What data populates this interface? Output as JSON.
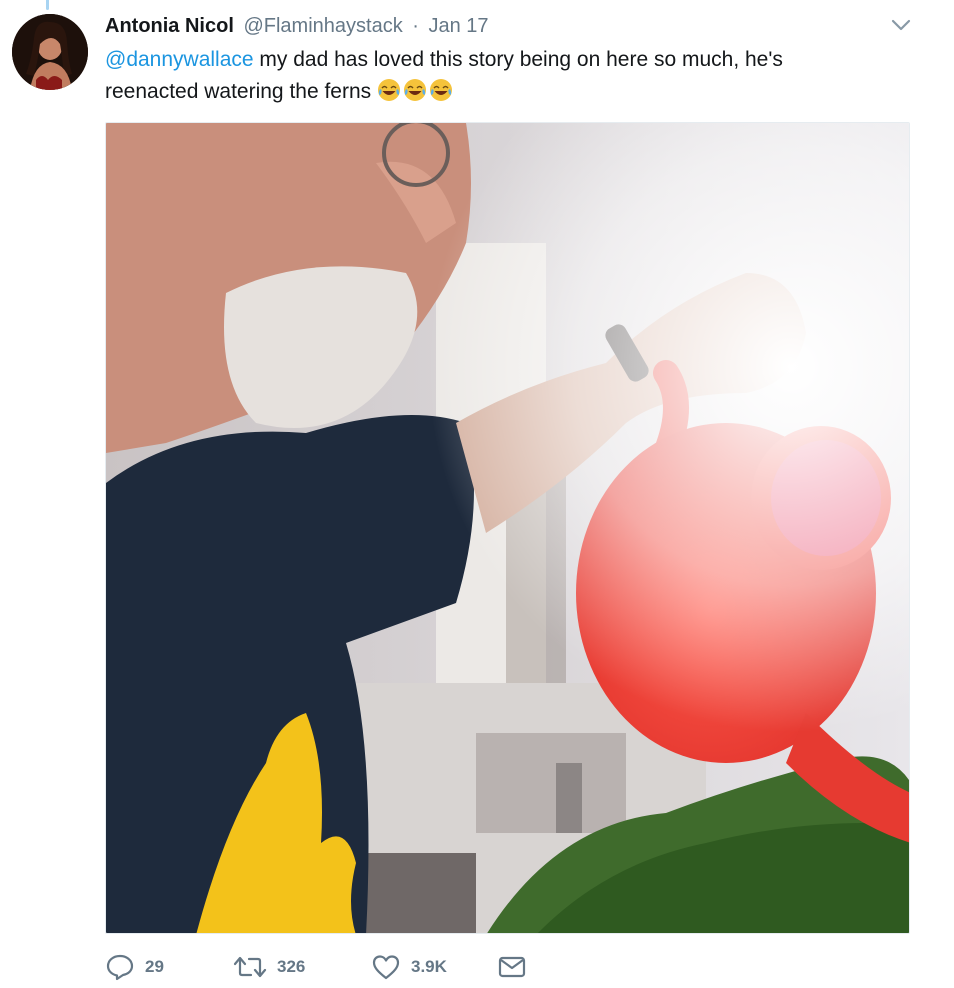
{
  "tweet": {
    "display_name": "Antonia Nicol",
    "handle": "@Flaminhaystack",
    "separator": "·",
    "date": "Jan 17",
    "mention": "@dannywallace",
    "text_line1": " my dad has loved this story being on here so much, he's",
    "text_line2": "reenacted watering the ferns ",
    "emoji": [
      "face-with-tears-of-joy",
      "face-with-tears-of-joy",
      "face-with-tears-of-joy"
    ]
  },
  "media": {
    "description_icon": "photo"
  },
  "actions": {
    "reply_icon": "reply-icon",
    "reply_count": "29",
    "retweet_icon": "retweet-icon",
    "retweet_count": "326",
    "like_icon": "heart-icon",
    "like_count": "3.9K",
    "dm_icon": "envelope-icon"
  },
  "colors": {
    "link": "#1b95e0",
    "muted": "#657786",
    "text": "#14171a",
    "watering_can": "#f2423a"
  }
}
